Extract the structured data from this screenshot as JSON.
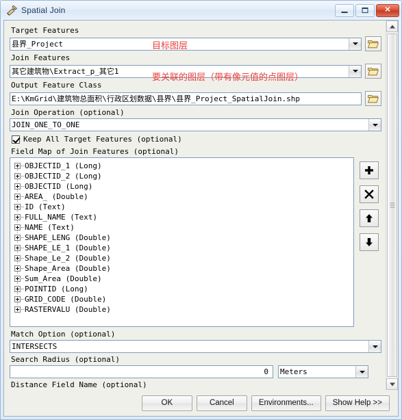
{
  "window": {
    "title": "Spatial Join",
    "tool_icon": "hammer-tool-icon",
    "minimize_label": "Minimize",
    "maximize_label": "Maximize",
    "close_label": "Close"
  },
  "form": {
    "target_features": {
      "label": "Target Features",
      "value": "县界_Project",
      "annotation": "目标图层",
      "browse_icon": "open-folder-icon"
    },
    "join_features": {
      "label": "Join Features",
      "value": "其它建筑物\\Extract_p_其它1",
      "annotation": "要关联的图层（带有像元值的点图层）",
      "browse_icon": "open-folder-icon"
    },
    "output_feature_class": {
      "label": "Output Feature Class",
      "value": "E:\\KmGrid\\建筑物总面积\\行政区划数据\\县界\\县界_Project_SpatialJoin.shp",
      "browse_icon": "open-folder-icon"
    },
    "join_operation": {
      "label": "Join Operation  (optional)",
      "value": "JOIN_ONE_TO_ONE"
    },
    "keep_all_target_features": {
      "label": "Keep All Target Features  (optional)",
      "checked": "true"
    },
    "field_map": {
      "label": "Field Map of Join Features  (optional)",
      "items": [
        "OBJECTID_1 (Long)",
        "OBJECTID_2 (Long)",
        "OBJECTID (Long)",
        "AREA_ (Double)",
        "ID (Text)",
        "FULL_NAME (Text)",
        "NAME (Text)",
        "SHAPE_LENG (Double)",
        "SHAPE_LE_1 (Double)",
        "Shape_Le_2 (Double)",
        "Shape_Area (Double)",
        "Sum_Area (Double)",
        "POINTID (Long)",
        "GRID_CODE (Double)",
        "RASTERVALU (Double)"
      ],
      "buttons": [
        {
          "name": "add",
          "icon": "plus-icon"
        },
        {
          "name": "delete",
          "icon": "cross-icon"
        },
        {
          "name": "move-up",
          "icon": "arrow-up-icon"
        },
        {
          "name": "move-down",
          "icon": "arrow-down-icon"
        }
      ]
    },
    "match_option": {
      "label": "Match Option  (optional)",
      "value": "INTERSECTS"
    },
    "search_radius": {
      "label": "Search Radius  (optional)",
      "value": "0",
      "units": "Meters"
    },
    "distance_field_name": {
      "label": "Distance Field Name  (optional)"
    }
  },
  "footer": {
    "ok": "OK",
    "cancel": "Cancel",
    "environments": "Environments...",
    "show_help": "Show Help >>"
  },
  "colors": {
    "annotation": "#e8423c",
    "title_text": "#1b3a5c",
    "close_button": "#c43a22"
  }
}
